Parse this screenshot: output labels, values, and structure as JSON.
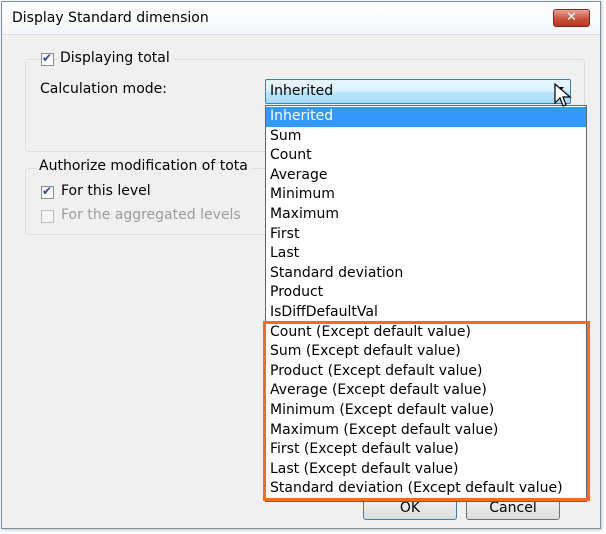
{
  "dialog": {
    "title": "Display Standard dimension",
    "close_label": "✕"
  },
  "totals_group": {
    "displaying_total_label": "Displaying total",
    "displaying_total_checked": true,
    "calculation_mode_label": "Calculation mode:",
    "calculation_mode_value": "Inherited"
  },
  "authorize_group": {
    "legend": "Authorize modification of tota",
    "for_this_level_label": "For this level",
    "for_this_level_checked": true,
    "for_aggregated_label": "For the aggregated levels",
    "for_aggregated_checked": false
  },
  "buttons": {
    "ok_label": "OK",
    "cancel_label": "Cancel"
  },
  "dropdown": {
    "selected": "Inherited",
    "options": [
      "Inherited",
      "Sum",
      "Count",
      "Average",
      "Minimum",
      "Maximum",
      "First",
      "Last",
      "Standard deviation",
      "Product",
      "IsDiffDefaultVal",
      "Count (Except default value)",
      "Sum (Except default value)",
      "Product (Except default value)",
      "Average (Except default value)",
      "Minimum (Except default value)",
      "Maximum (Except default value)",
      "First (Except default value)",
      "Last (Except default value)",
      "Standard deviation (Except default value)"
    ]
  },
  "colors": {
    "highlight": "#f26b25",
    "selection": "#3399ff"
  }
}
